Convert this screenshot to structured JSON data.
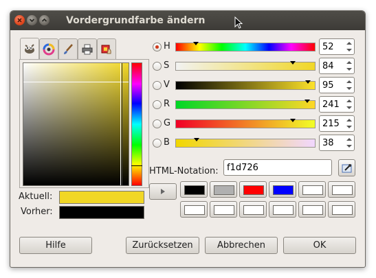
{
  "window": {
    "title": "Vordergrundfarbe ändern"
  },
  "tabs": [
    {
      "icon": "gimp-wilber-icon",
      "active": true
    },
    {
      "icon": "color-wheel-icon",
      "active": false
    },
    {
      "icon": "paint-brush-icon",
      "active": false
    },
    {
      "icon": "printer-cmyk-icon",
      "active": false
    },
    {
      "icon": "palette-watercolor-icon",
      "active": false
    }
  ],
  "swatches": {
    "current_label": "Aktuell:",
    "previous_label": "Vorher:",
    "current_color": "#f1d726",
    "previous_color": "#000000"
  },
  "channels": [
    {
      "label": "H",
      "value": "52",
      "checked": true
    },
    {
      "label": "S",
      "value": "84",
      "checked": false
    },
    {
      "label": "V",
      "value": "95",
      "checked": false
    },
    {
      "label": "R",
      "value": "241",
      "checked": false
    },
    {
      "label": "G",
      "value": "215",
      "checked": false
    },
    {
      "label": "B",
      "value": "38",
      "checked": false
    }
  ],
  "html_notation": {
    "label": "HTML-Notation:",
    "value": "f1d726"
  },
  "history": [
    "#000000",
    "#b0b0b0",
    "#ff0000",
    "#0000ff",
    "#ffffff",
    "#ffffff",
    "#ffffff",
    "#ffffff",
    "#ffffff",
    "#ffffff",
    "#ffffff",
    "#ffffff"
  ],
  "buttons": {
    "help": "Hilfe",
    "reset": "Zurücksetzen",
    "cancel": "Abbrechen",
    "ok": "OK"
  }
}
